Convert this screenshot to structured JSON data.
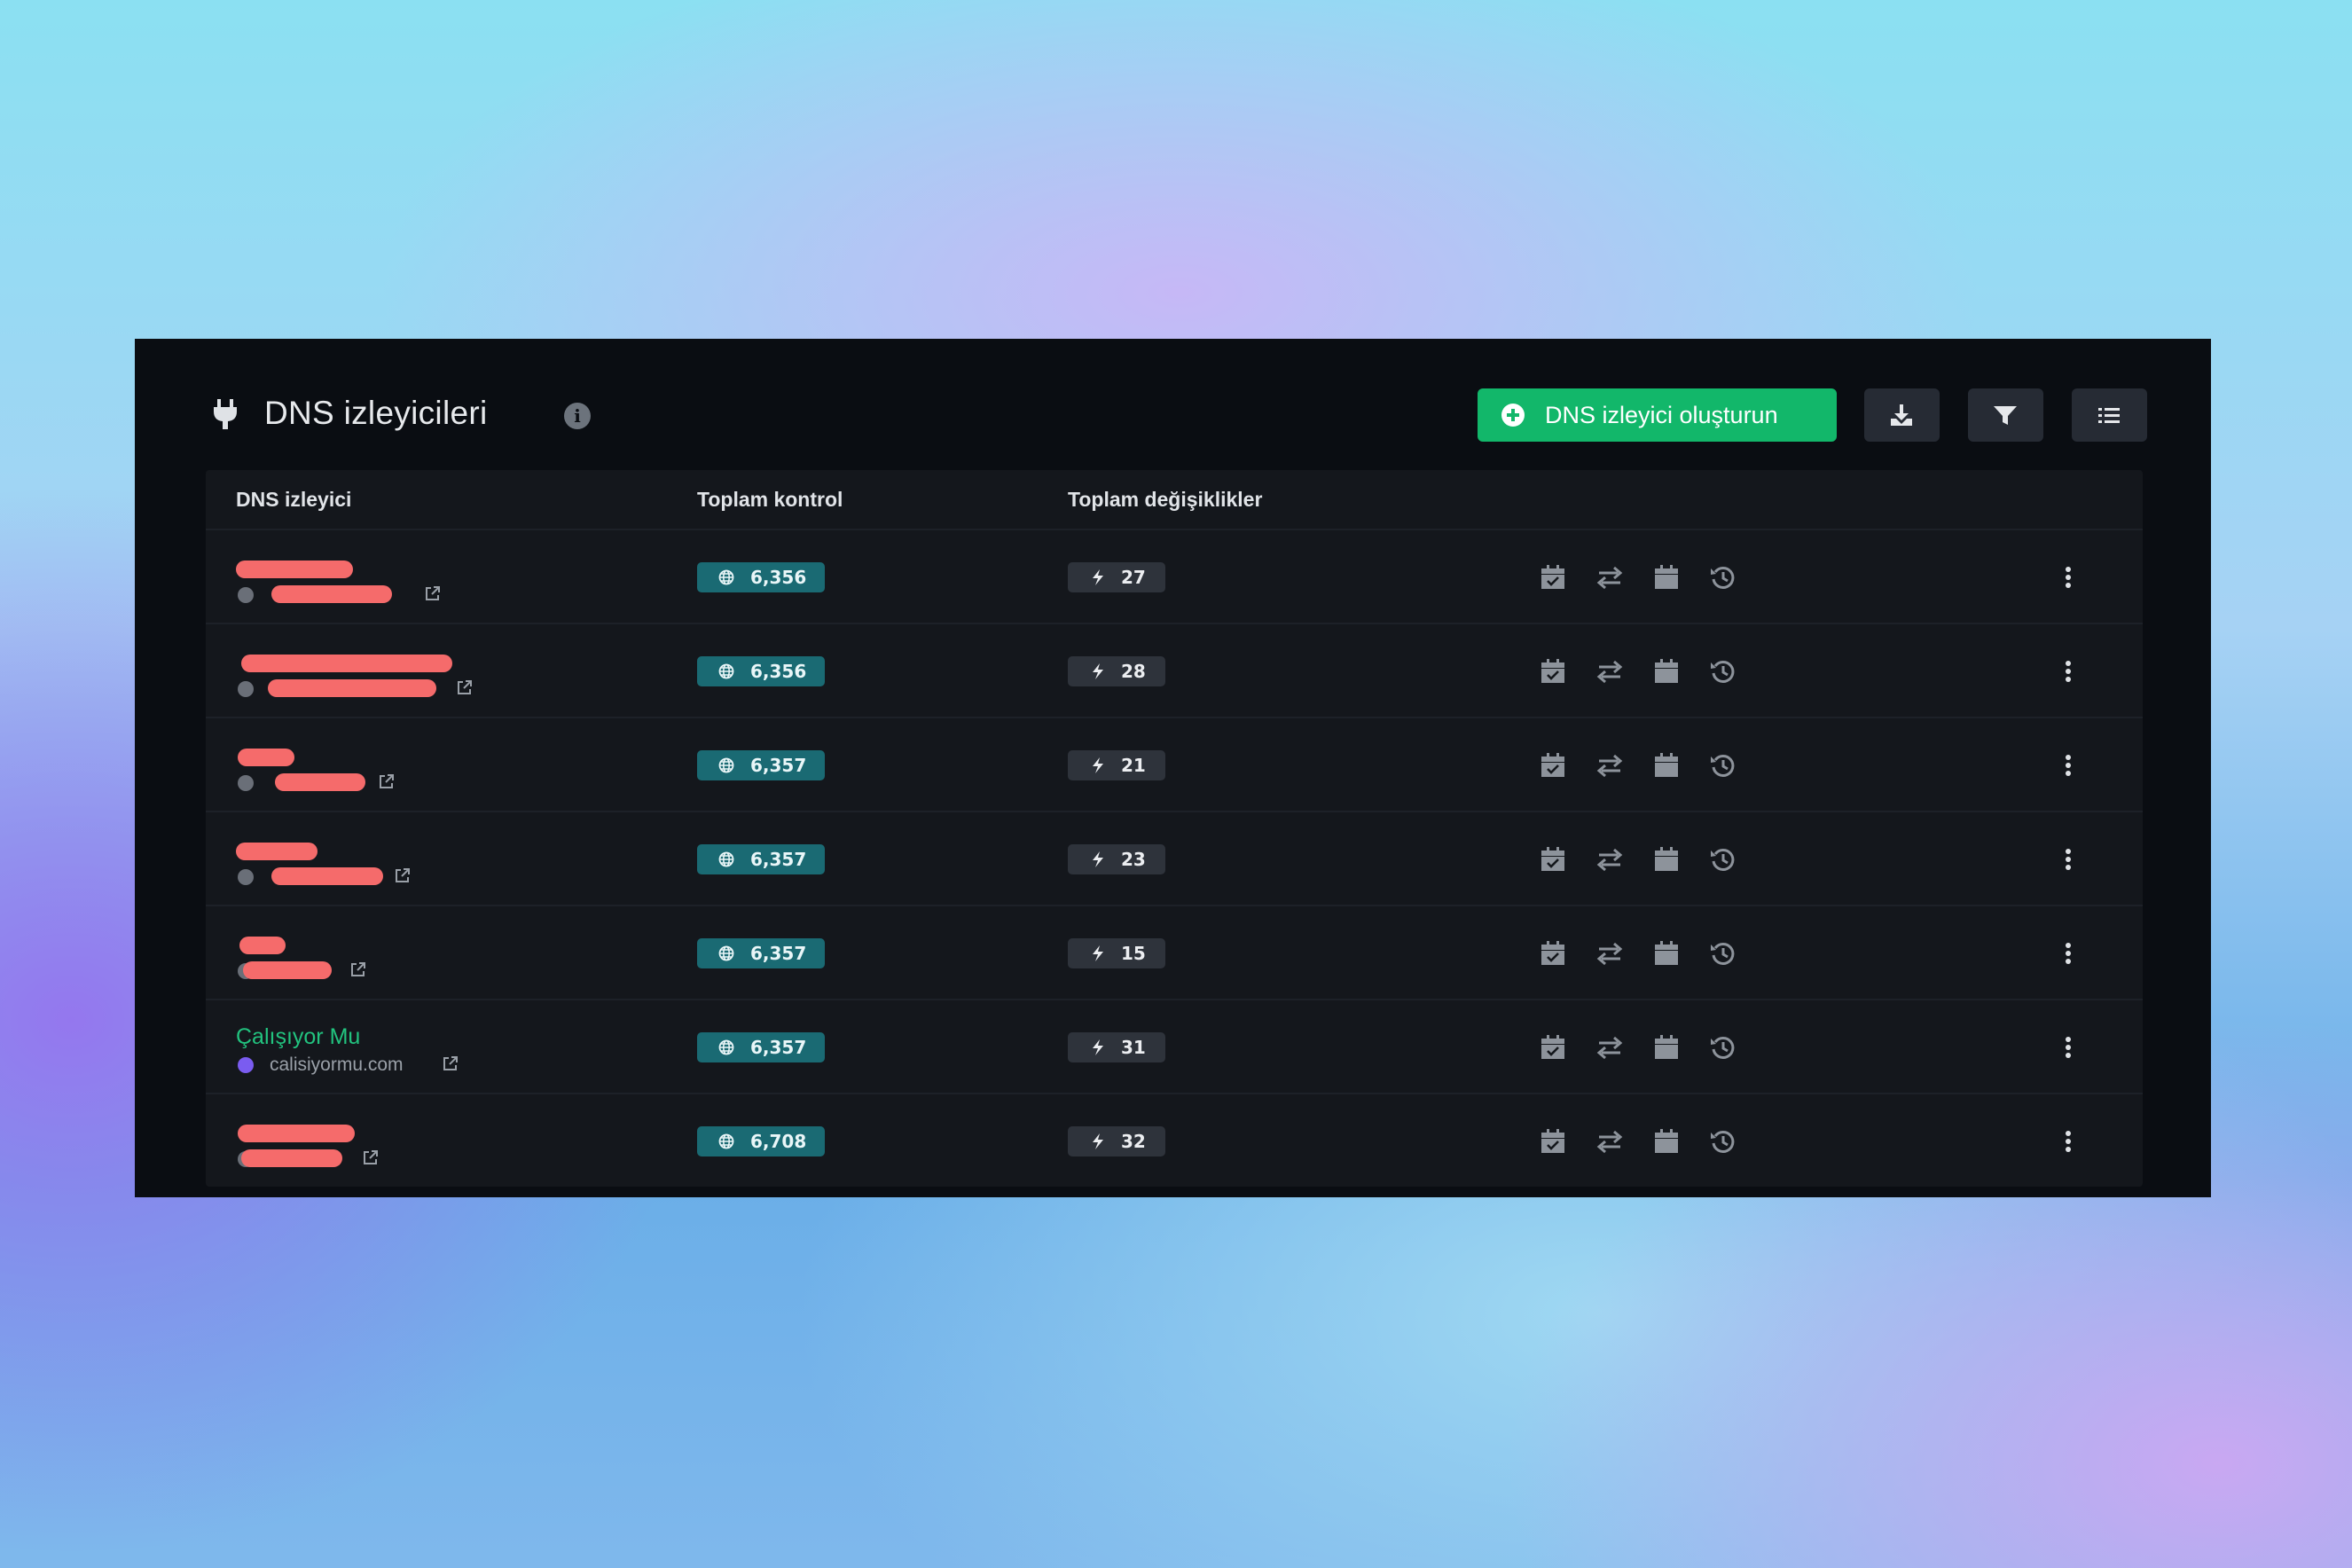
{
  "header": {
    "title": "DNS izleyicileri",
    "create_button_label": "DNS izleyici oluşturun"
  },
  "table": {
    "columns": [
      "DNS izleyici",
      "Toplam kontrol",
      "Toplam değişiklikler"
    ],
    "rows": [
      {
        "name": "",
        "domain": "",
        "total_checks": "6,356",
        "total_changes": "27"
      },
      {
        "name": "",
        "domain": "",
        "total_checks": "6,356",
        "total_changes": "28"
      },
      {
        "name": "",
        "domain": "",
        "total_checks": "6,357",
        "total_changes": "21"
      },
      {
        "name": "",
        "domain": "",
        "total_checks": "6,357",
        "total_changes": "23"
      },
      {
        "name": "",
        "domain": "",
        "total_checks": "6,357",
        "total_changes": "15"
      },
      {
        "name": "Çalışıyor Mu",
        "domain": "calisiyormu.com",
        "total_checks": "6,357",
        "total_changes": "31"
      },
      {
        "name": "",
        "domain": "",
        "total_checks": "6,708",
        "total_changes": "32"
      }
    ]
  },
  "colors": {
    "panel_bg": "#0a0d12",
    "accent_green": "#12b76a",
    "checks_badge": "#1a6a73",
    "changes_badge": "#2e333b",
    "redaction": "#f56b6b"
  },
  "icons": [
    "plug-icon",
    "info-icon",
    "plus-circle-icon",
    "download-icon",
    "filter-icon",
    "list-icon",
    "globe-icon",
    "bolt-icon",
    "calendar-check-icon",
    "swap-icon",
    "calendar-icon",
    "history-icon",
    "external-link-icon",
    "kebab-menu-icon"
  ]
}
